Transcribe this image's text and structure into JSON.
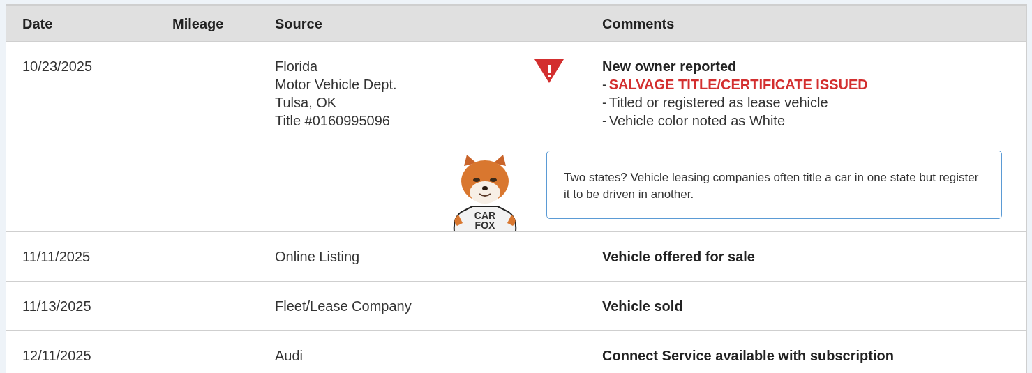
{
  "table": {
    "columns": [
      "Date",
      "Mileage",
      "Source",
      "Comments"
    ],
    "rows": [
      {
        "date": "10/23/2025",
        "source": [
          "Florida",
          "Motor Vehicle Dept.",
          "Tulsa, OK",
          "Title #0160995096"
        ],
        "alert": true,
        "comments": [
          {
            "kind": "headline",
            "text": "New owner reported"
          },
          {
            "kind": "alert",
            "bullet": "-",
            "text": "SALVAGE TITLE/CERTIFICATE ISSUED"
          },
          {
            "kind": "note",
            "bullet": "-",
            "text": "Titled or registered as lease vehicle"
          },
          {
            "kind": "note",
            "bullet": "-",
            "text": "Vehicle color noted as White"
          }
        ],
        "tip": {
          "mascot_shirt": [
            "CAR",
            "FOX"
          ],
          "text": "Two states? Vehicle leasing companies often title a car in one state but register it to be driven in another."
        }
      },
      {
        "date": "11/11/2025",
        "source": [
          "Online Listing"
        ],
        "alert": false,
        "comments": [
          {
            "kind": "headline",
            "text": "Vehicle offered for sale"
          }
        ]
      },
      {
        "date": "11/13/2025",
        "source": [
          "Fleet/Lease Company"
        ],
        "alert": false,
        "comments": [
          {
            "kind": "headline",
            "text": "Vehicle sold"
          }
        ]
      },
      {
        "date": "12/11/2025",
        "source": [
          "Audi"
        ],
        "alert": false,
        "comments": [
          {
            "kind": "headline",
            "text": "Connect Service available with subscription"
          }
        ]
      }
    ]
  }
}
